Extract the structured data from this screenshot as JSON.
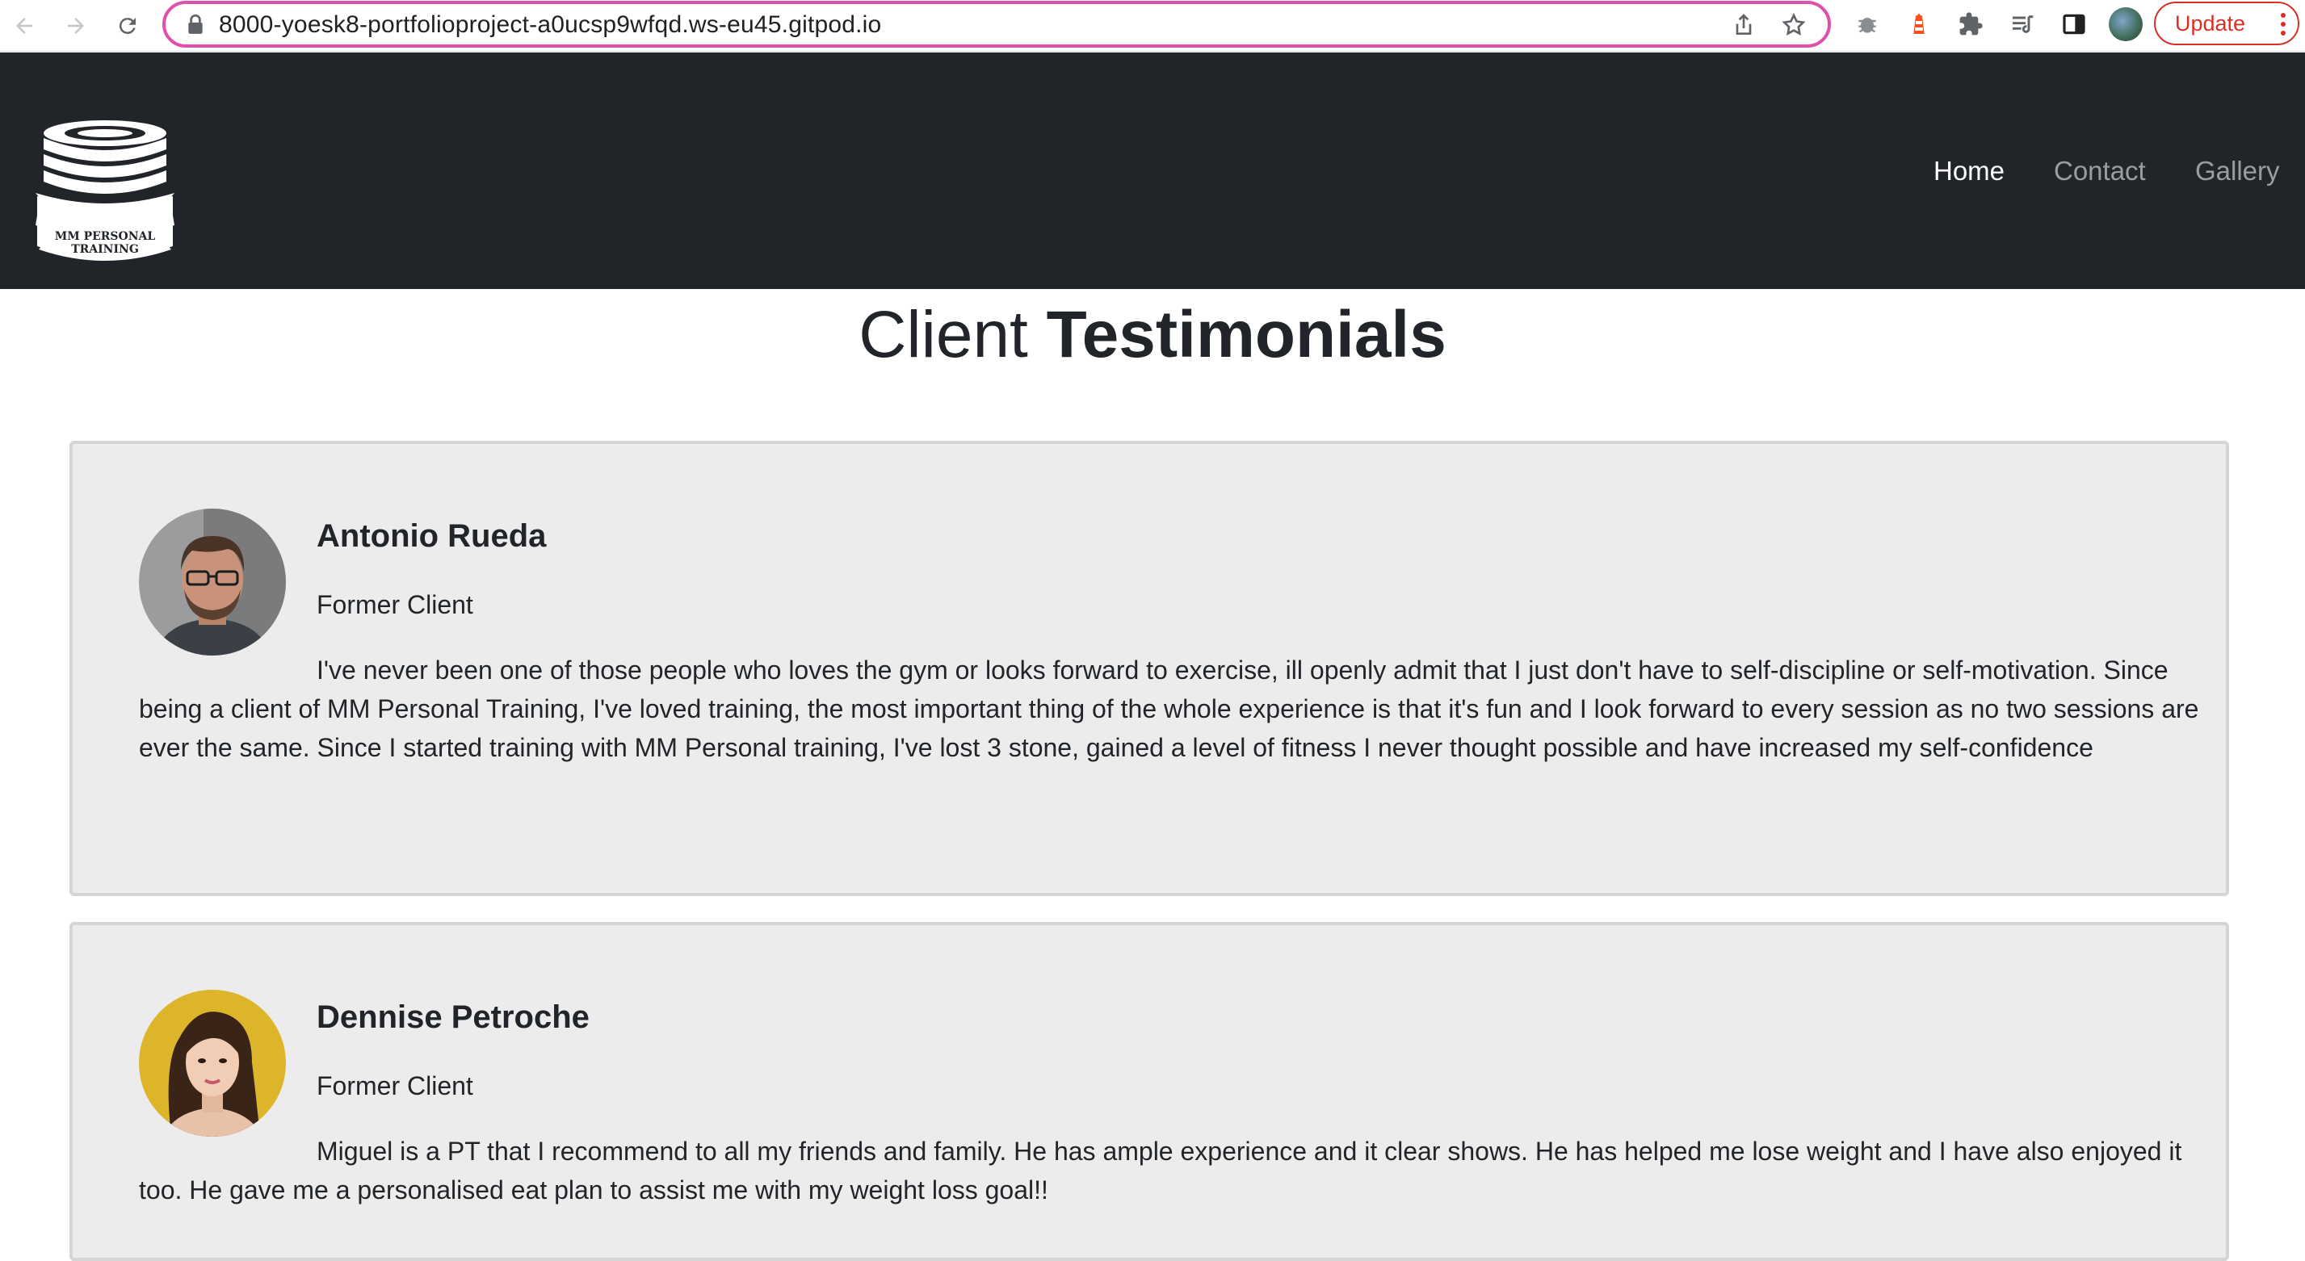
{
  "browser": {
    "url": "8000-yoesk8-portfolioproject-a0ucsp9wfqd.ws-eu45.gitpod.io",
    "update_label": "Update"
  },
  "site": {
    "logo_text": [
      "MM PERSONAL",
      "TRAINING"
    ],
    "nav": [
      {
        "label": "Home",
        "active": true
      },
      {
        "label": "Contact",
        "active": false
      },
      {
        "label": "Gallery",
        "active": false
      }
    ]
  },
  "main": {
    "title_light": "Client",
    "title_bold": "Testimonials",
    "testimonials": [
      {
        "name": "Antonio Rueda",
        "role": "Former Client",
        "quote": "I've never been one of those people who loves the gym or looks forward to exercise, ill openly admit that I just don't have to self-discipline or self-motivation. Since being a client of MM Personal Training, I've loved training, the most important thing of the whole experience is that it's fun and I look forward to every session as no two sessions are ever the same. Since I started training with MM Personal training, I've lost 3 stone, gained a level of fitness I never thought possible and have increased my self-confidence"
      },
      {
        "name": "Dennise Petroche",
        "role": "Former Client",
        "quote": "Miguel is a PT that I recommend to all my friends and family. He has ample experience and it clear shows. He has helped me lose weight and I have also enjoyed it too. He gave me a personalised eat plan to assist me with my weight loss goal!!"
      }
    ]
  },
  "colors": {
    "navbar_bg": "#212529",
    "card_bg": "#ececec",
    "omnibox_border": "#e04fa9",
    "update_red": "#d93025"
  }
}
